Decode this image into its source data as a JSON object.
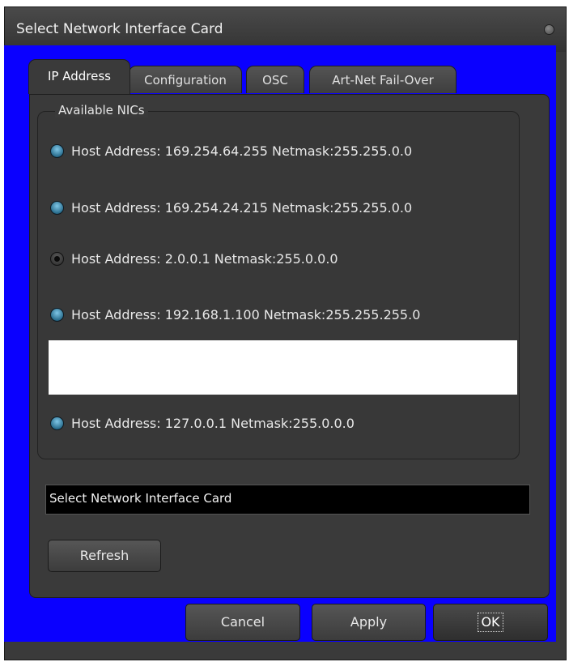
{
  "window": {
    "title": "Select Network Interface Card"
  },
  "tabs": [
    {
      "label": "IP Address",
      "active": true
    },
    {
      "label": "Configuration",
      "active": false
    },
    {
      "label": "OSC",
      "active": false
    },
    {
      "label": "Art-Net Fail-Over",
      "active": false
    }
  ],
  "group": {
    "label": "Available NICs"
  },
  "nics": [
    {
      "label": "Host Address: 169.254.64.255 Netmask:255.255.0.0",
      "selected": false
    },
    {
      "label": "Host Address: 169.254.24.215 Netmask:255.255.0.0",
      "selected": false
    },
    {
      "label": "Host Address: 2.0.0.1 Netmask:255.0.0.0",
      "selected": true
    },
    {
      "label": "Host Address: 192.168.1.100 Netmask:255.255.255.0",
      "selected": false
    },
    {
      "label": "Host Address: 127.0.0.1 Netmask:255.0.0.0",
      "selected": false
    }
  ],
  "status_text": "Select Network Interface Card",
  "buttons": {
    "refresh": "Refresh",
    "cancel": "Cancel",
    "apply": "Apply",
    "ok": "OK"
  },
  "colors": {
    "background": "#3a3a3a",
    "accent_blue": "#0a00ff",
    "radio_unselected": "#2b6f8f"
  }
}
